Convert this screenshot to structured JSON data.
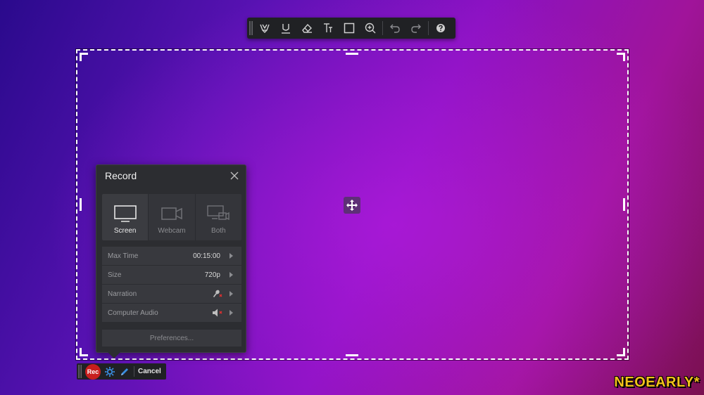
{
  "toolbar": {
    "tools": [
      {
        "icon": "highlighter-pen-icon"
      },
      {
        "icon": "highlighter-icon"
      },
      {
        "icon": "eraser-icon"
      },
      {
        "icon": "text-tool-icon"
      },
      {
        "icon": "rectangle-tool-icon"
      },
      {
        "icon": "zoom-in-icon"
      },
      {
        "icon": "undo-icon"
      },
      {
        "icon": "redo-icon"
      },
      {
        "icon": "help-icon"
      }
    ]
  },
  "record_panel": {
    "title": "Record",
    "modes": [
      {
        "label": "Screen",
        "icon": "monitor-icon",
        "active": true
      },
      {
        "label": "Webcam",
        "icon": "webcam-icon",
        "active": false
      },
      {
        "label": "Both",
        "icon": "screen-and-webcam-icon",
        "active": false
      }
    ],
    "settings": [
      {
        "label": "Max Time",
        "value": "00:15:00"
      },
      {
        "label": "Size",
        "value": "720p"
      },
      {
        "label": "Narration",
        "value": "",
        "icon": "microphone-muted-icon"
      },
      {
        "label": "Computer Audio",
        "value": "",
        "icon": "speaker-muted-icon"
      }
    ],
    "preferences_label": "Preferences..."
  },
  "bottom_bar": {
    "rec_label": "Rec",
    "cancel_label": "Cancel"
  },
  "watermark": "NEOEARLY*",
  "colors": {
    "accent_red": "#c81e1e",
    "panel_bg": "#2c2d31",
    "watermark_yellow": "#f2c21a",
    "settings_blue": "#3a8de0"
  }
}
